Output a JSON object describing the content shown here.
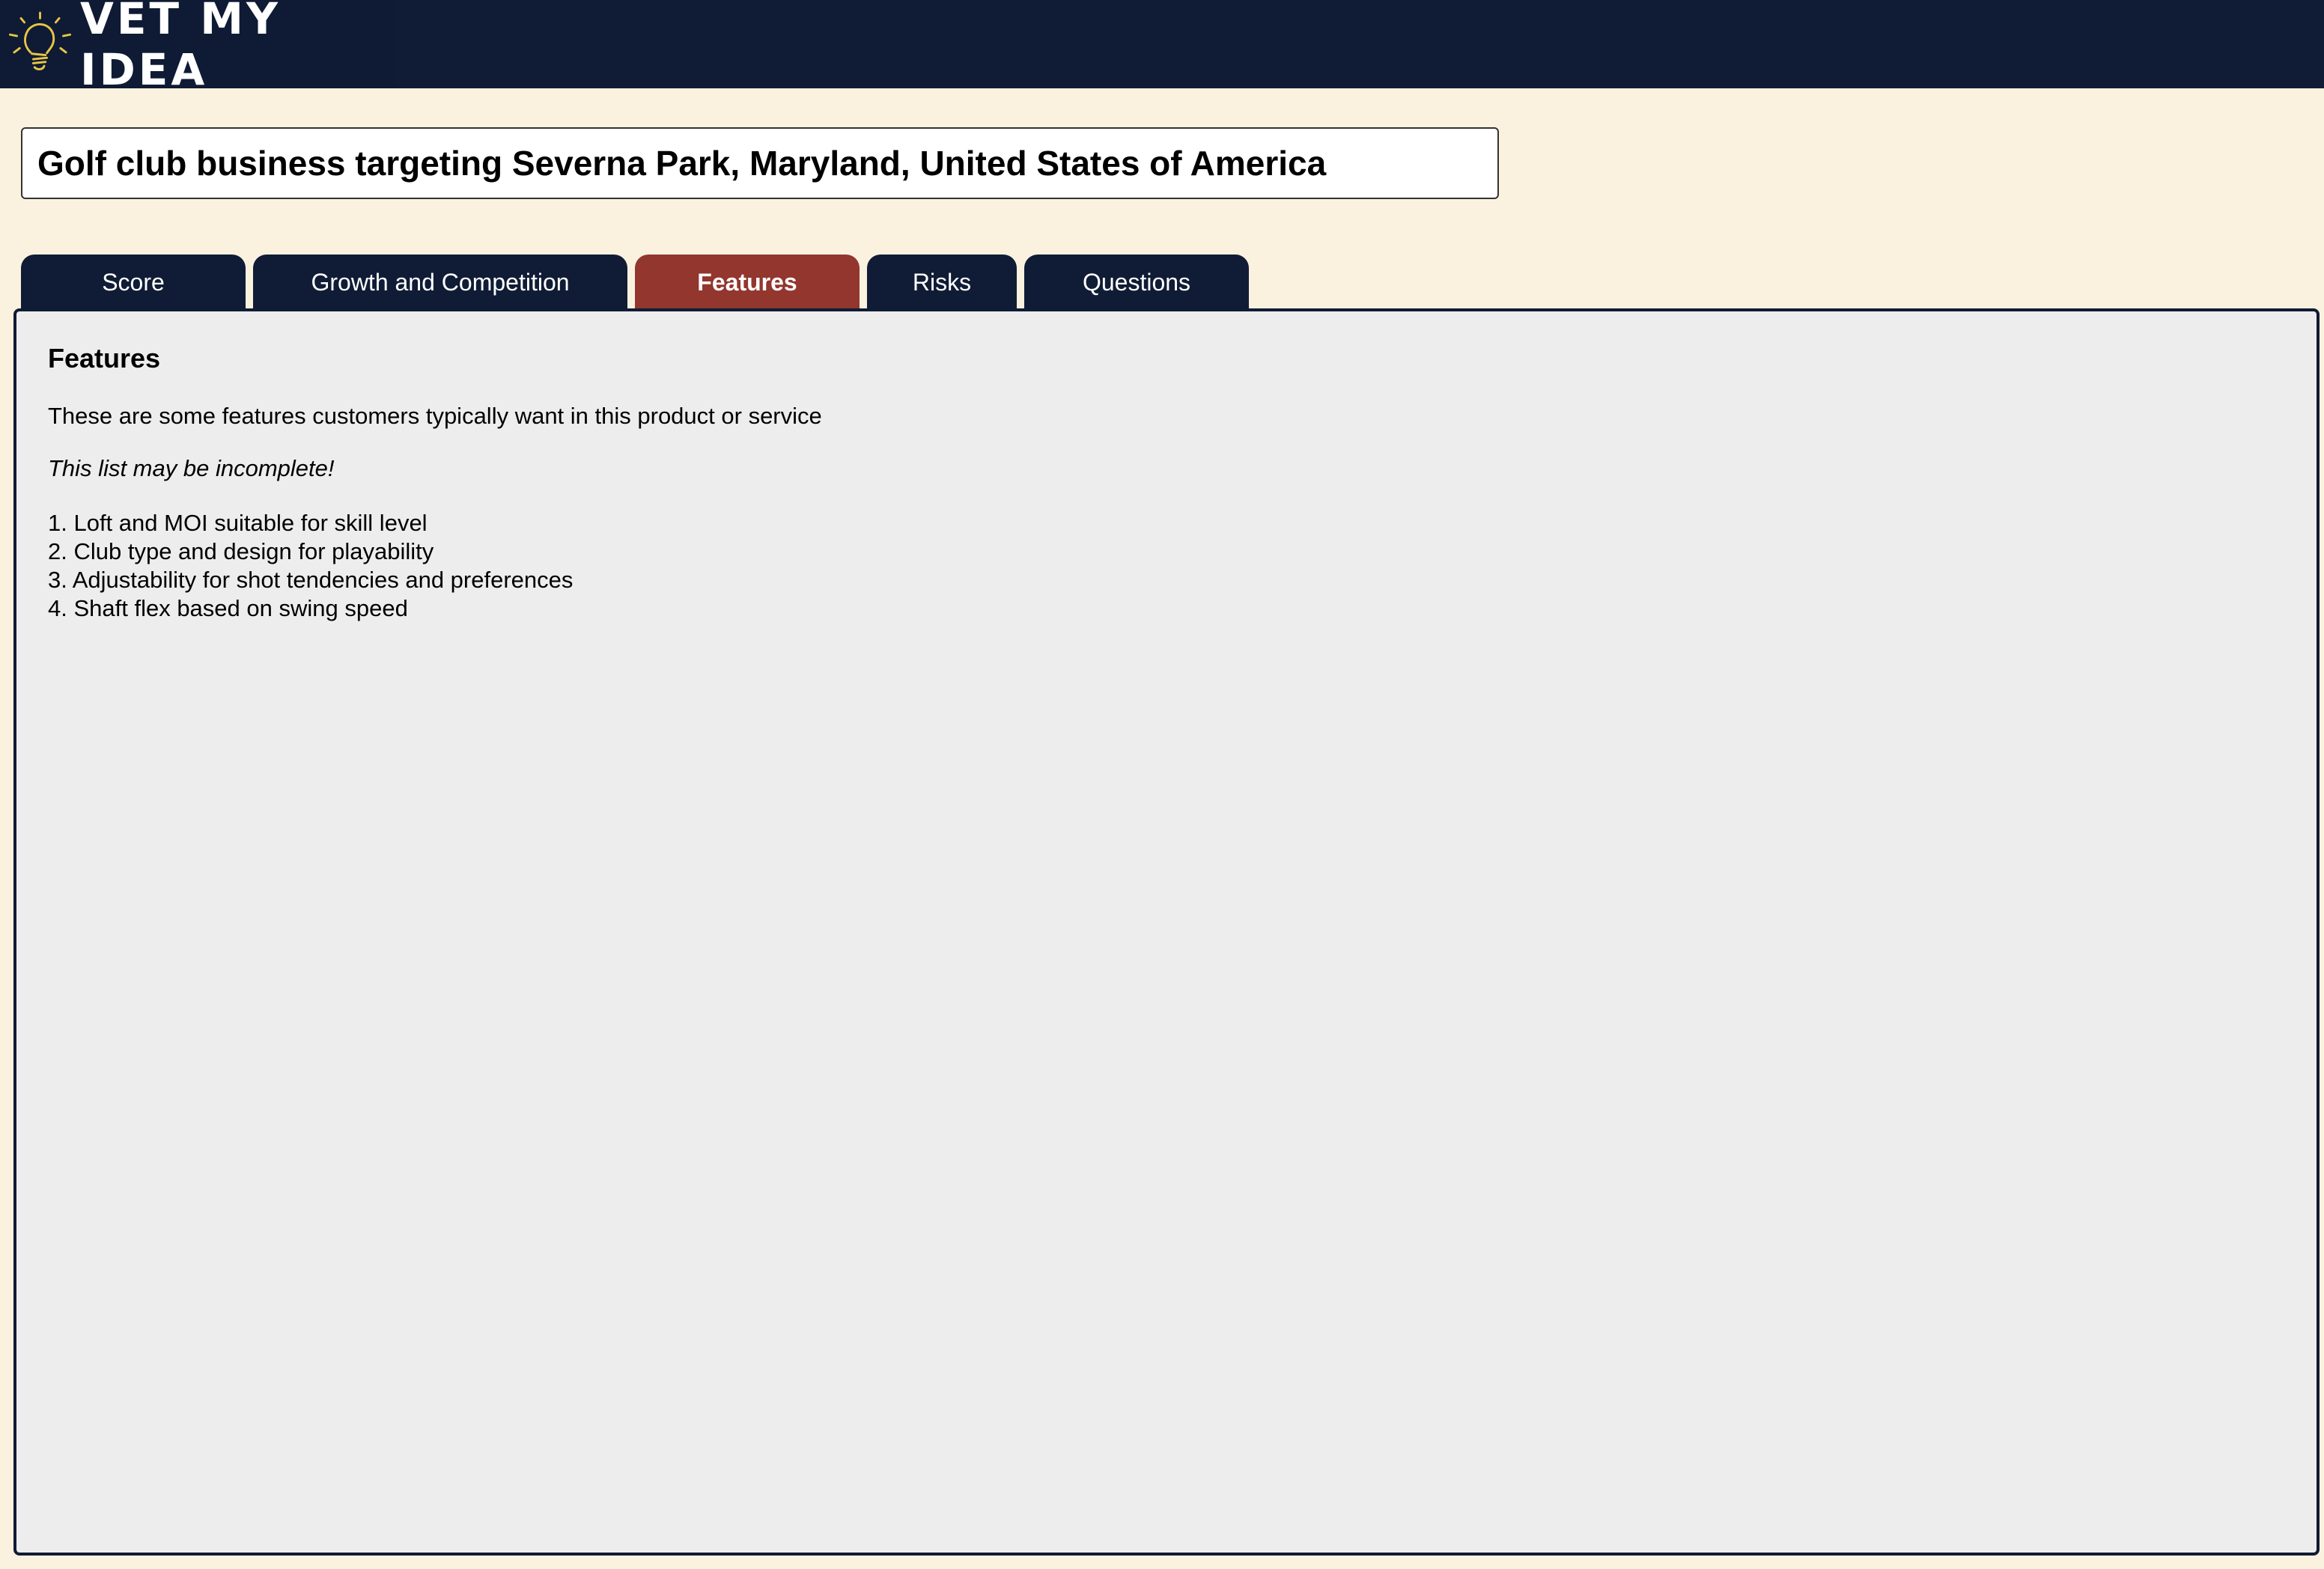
{
  "brand": {
    "name": "VET MY IDEA",
    "icon": "lightbulb-icon",
    "icon_color": "#e8c547"
  },
  "idea": {
    "title": "Golf club business targeting Severna Park, Maryland, United States of America"
  },
  "tabs": [
    {
      "label": "Score",
      "active": false
    },
    {
      "label": "Growth and Competition",
      "active": false
    },
    {
      "label": "Features",
      "active": true
    },
    {
      "label": "Risks",
      "active": false
    },
    {
      "label": "Questions",
      "active": false
    }
  ],
  "colors": {
    "nav": "#101c35",
    "active_tab": "#92362e",
    "page_bg": "#faf2df",
    "panel_bg": "#ededed"
  },
  "panel": {
    "heading": "Features",
    "intro": "These are some features customers typically want in this product or service",
    "note": "This list may be incomplete!",
    "items": [
      "1. Loft and MOI suitable for skill level",
      "2. Club type and design for playability",
      "3. Adjustability for shot tendencies and preferences",
      "4. Shaft flex based on swing speed"
    ]
  }
}
